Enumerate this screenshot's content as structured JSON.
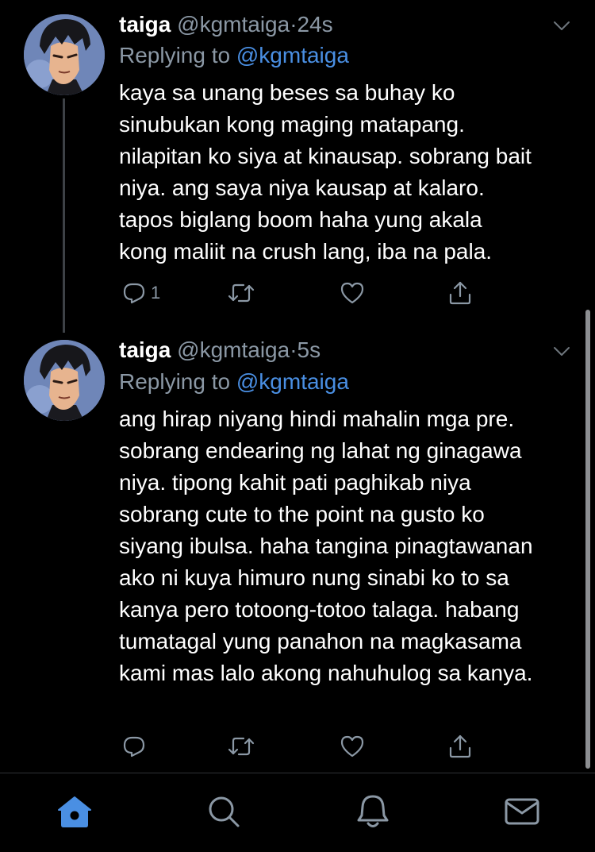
{
  "colors": {
    "background": "#000000",
    "text_primary": "#ffffff",
    "text_secondary": "#8b98a5",
    "accent": "#4a8fe3",
    "thread_line": "#3d4146"
  },
  "tweets": [
    {
      "display_name": "taiga",
      "handle": "@kgmtaiga",
      "separator": "·",
      "time": "24s",
      "replying_to_label": "Replying to",
      "replying_to_handle": "@kgmtaiga",
      "lines": [
        "kaya sa unang beses sa buhay ko",
        "sinubukan kong maging matapang.",
        "nilapitan ko siya at kinausap. sobrang bait",
        "niya. ang saya niya kausap at kalaro.",
        "tapos biglang boom haha yung akala",
        "kong maliit na crush lang, iba na pala."
      ],
      "reply_count": "1",
      "icons": {
        "reply": "reply-icon",
        "retweet": "retweet-icon",
        "like": "like-icon",
        "share": "share-icon",
        "menu": "chevron-down-icon"
      }
    },
    {
      "display_name": "taiga",
      "handle": "@kgmtaiga",
      "separator": "·",
      "time": "5s",
      "replying_to_label": "Replying to",
      "replying_to_handle": "@kgmtaiga",
      "lines": [
        "ang hirap niyang hindi mahalin mga pre.",
        "sobrang endearing ng lahat ng ginagawa",
        "niya. tipong kahit pati paghikab niya",
        "sobrang cute to the point na gusto ko",
        "siyang ibulsa. haha tangina pinagtawanan",
        "ako ni kuya himuro nung sinabi ko to sa",
        "kanya pero totoong-totoo talaga. habang",
        "tumatagal yung panahon na magkasama",
        "kami mas lalo akong nahuhulog sa kanya."
      ],
      "reply_count": "",
      "icons": {
        "reply": "reply-icon",
        "retweet": "retweet-icon",
        "like": "like-icon",
        "share": "share-icon",
        "menu": "chevron-down-icon"
      }
    }
  ],
  "tab_bar": {
    "active": "home",
    "tabs": [
      {
        "id": "home",
        "icon": "home-icon"
      },
      {
        "id": "search",
        "icon": "search-icon"
      },
      {
        "id": "notifications",
        "icon": "bell-icon"
      },
      {
        "id": "messages",
        "icon": "mail-icon"
      }
    ]
  }
}
